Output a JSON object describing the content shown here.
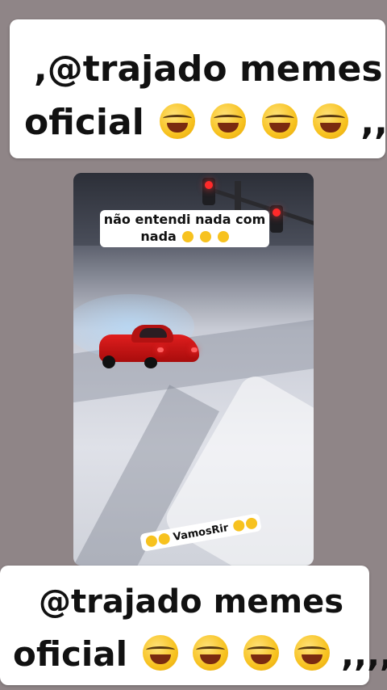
{
  "top_banner": {
    "line1": ",@trajado memes",
    "line2": "oficial",
    "line2_suffix": ",,",
    "emoji_name": "face-with-tears-of-joy-icon",
    "emoji_count": 4
  },
  "video": {
    "caption_line1": "não entendi nada com",
    "caption_line2": "nada",
    "watermark": "VamosRir"
  },
  "bottom_banner": {
    "line1": "@trajado memes",
    "line2": "oficial",
    "line2_suffix": ",,,,",
    "emoji_name": "face-with-tears-of-joy-icon",
    "emoji_count": 4
  },
  "colors": {
    "background": "#8f8587",
    "banner": "#ffffff",
    "car_red": "#e01e1e",
    "traffic_light_red": "#ff2a2a"
  }
}
